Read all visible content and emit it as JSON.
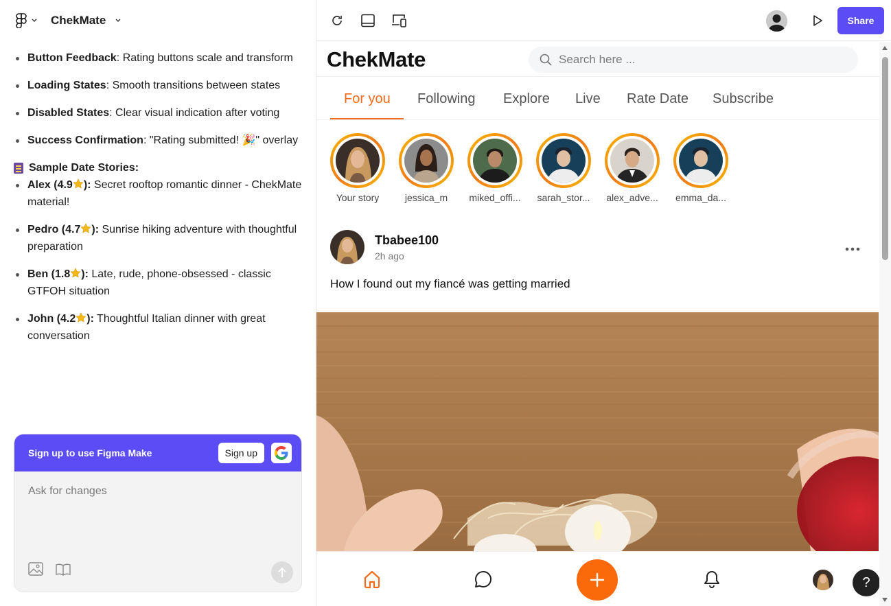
{
  "editor": {
    "project_title": "ChekMate",
    "toolbar": {
      "share_label": "Share"
    }
  },
  "notes": {
    "items_top": [
      {
        "bold": "Button Feedback",
        "text": ": Rating buttons scale and transform"
      },
      {
        "bold": "Loading States",
        "text": ": Smooth transitions between states"
      },
      {
        "bold": "Disabled States",
        "text": ": Clear visual indication after voting"
      },
      {
        "bold": "Success Confirmation",
        "text": ": \"Rating submitted! 🎉\" overlay"
      }
    ],
    "section_heading": "Sample Date Stories:",
    "stories": [
      {
        "bold_a": "Alex (4.9",
        "bold_b": "):",
        "text": " Secret rooftop romantic dinner - ChekMate material!"
      },
      {
        "bold_a": "Pedro (4.7",
        "bold_b": "):",
        "text": " Sunrise hiking adventure with thoughtful preparation"
      },
      {
        "bold_a": "Ben (1.8",
        "bold_b": "):",
        "text": " Late, rude, phone-obsessed - classic GTFOH situation"
      },
      {
        "bold_a": "John (4.2",
        "bold_b": "):",
        "text": " Thoughtful Italian dinner with great conversation"
      }
    ]
  },
  "chat": {
    "signup_prompt": "Sign up to use Figma Make",
    "signup_button": "Sign up",
    "placeholder": "Ask for changes"
  },
  "app": {
    "brand": "ChekMate",
    "search_placeholder": "Search here ...",
    "tabs": [
      "For you",
      "Following",
      "Explore",
      "Live",
      "Rate Date",
      "Subscribe"
    ],
    "active_tab": "For you",
    "stories": [
      "Your story",
      "jessica_m",
      "miked_offi...",
      "sarah_stor...",
      "alex_adve...",
      "emma_da..."
    ],
    "post": {
      "user": "Tbabee100",
      "time": "2h ago",
      "text": "How I found out my fiancé was getting married"
    },
    "help_label": "?"
  },
  "colors": {
    "accent_orange": "#f26b1d",
    "fab_orange": "#fa6a0a",
    "figma_purple": "#5b4cf5",
    "story_ring_gold": "#f7b900"
  }
}
